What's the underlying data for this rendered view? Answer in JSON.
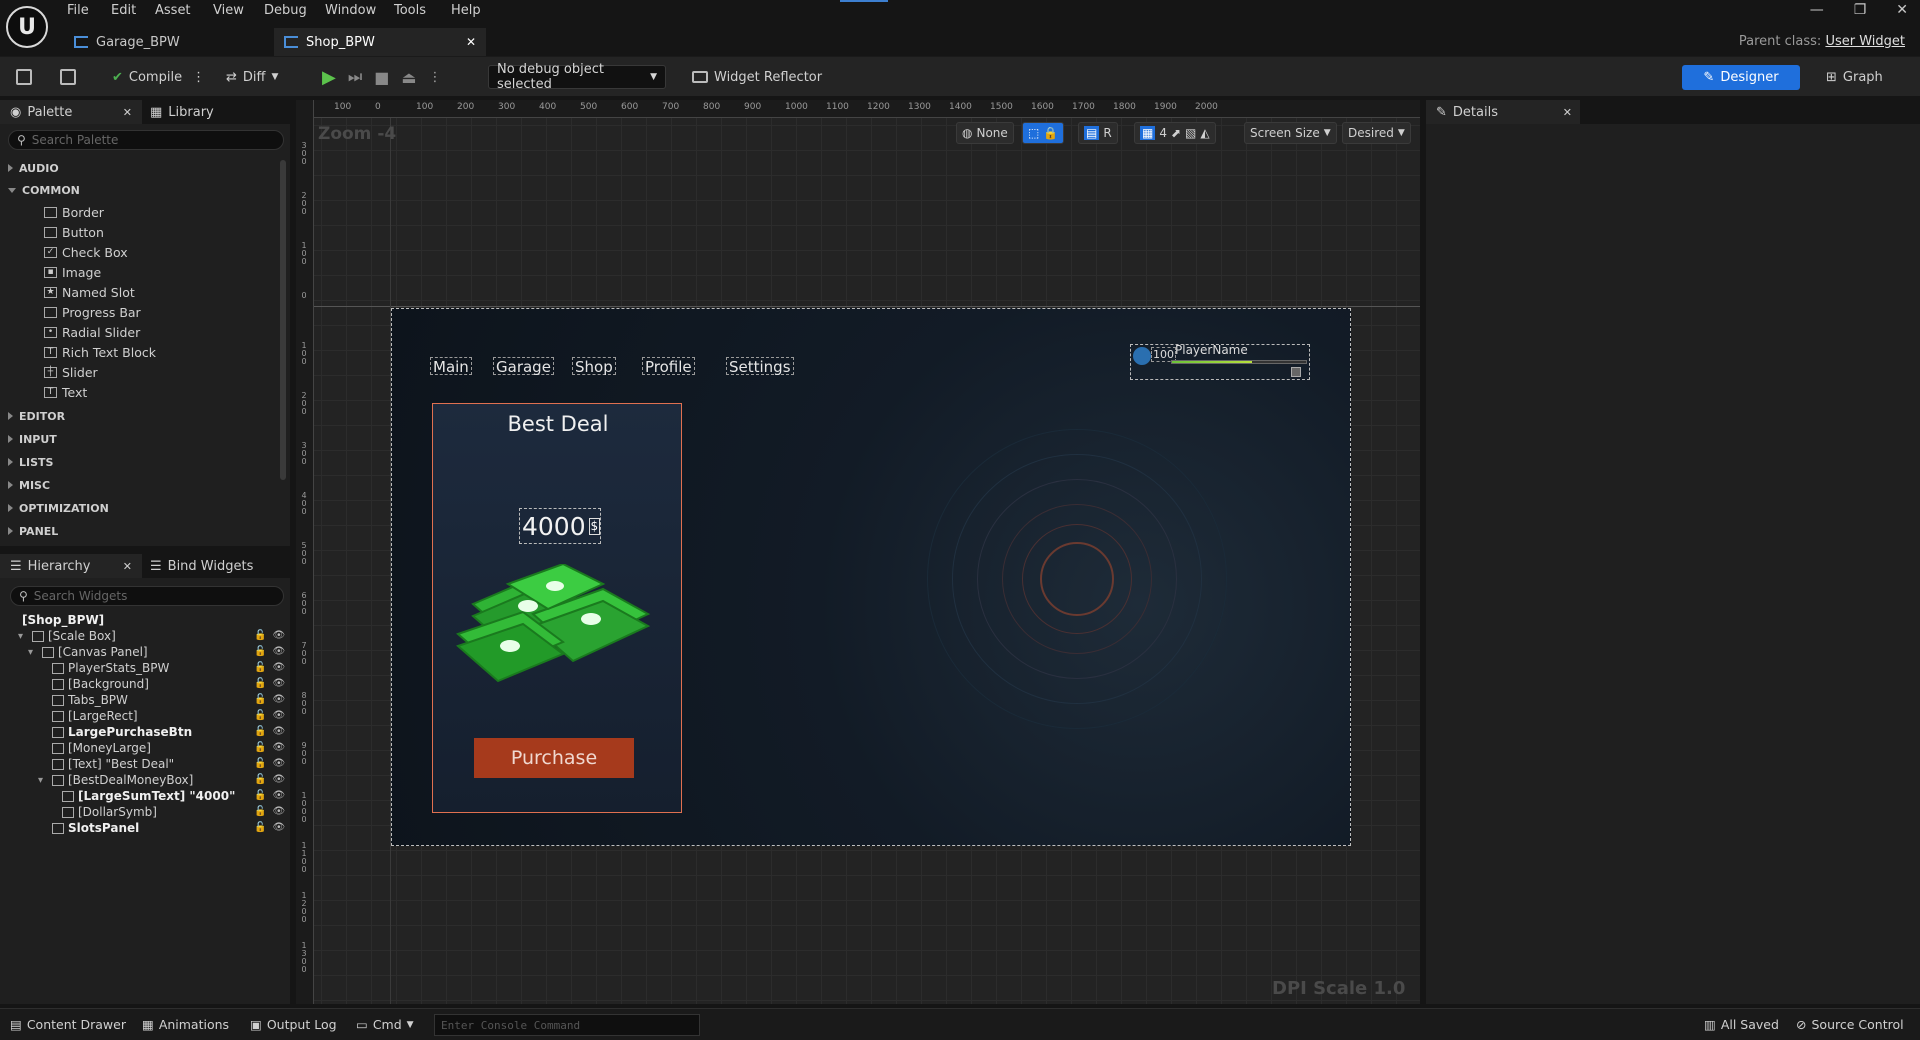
{
  "menu": [
    "File",
    "Edit",
    "Asset",
    "View",
    "Debug",
    "Window",
    "Tools",
    "Help"
  ],
  "tabs": [
    {
      "label": "Garage_BPW",
      "active": false
    },
    {
      "label": "Shop_BPW",
      "active": true
    }
  ],
  "parent_class": {
    "label": "Parent class:",
    "value": "User Widget"
  },
  "toolbar": {
    "compile": "Compile",
    "diff": "Diff",
    "debug_select": "No debug object selected",
    "widget_reflector": "Widget Reflector",
    "designer": "Designer",
    "graph": "Graph"
  },
  "palette": {
    "tab": "Palette",
    "library_tab": "Library",
    "search_placeholder": "Search Palette",
    "categories_top": [
      "AUDIO"
    ],
    "common_label": "COMMON",
    "common_items": [
      {
        "label": "Border",
        "icon": "border-icon",
        "glyph": ""
      },
      {
        "label": "Button",
        "icon": "button-icon",
        "glyph": ""
      },
      {
        "label": "Check Box",
        "icon": "checkbox-icon",
        "glyph": "✓"
      },
      {
        "label": "Image",
        "icon": "image-icon",
        "glyph": "▪"
      },
      {
        "label": "Named Slot",
        "icon": "named-slot-icon",
        "glyph": "★"
      },
      {
        "label": "Progress Bar",
        "icon": "progress-bar-icon",
        "glyph": ""
      },
      {
        "label": "Radial Slider",
        "icon": "radial-slider-icon",
        "glyph": "•"
      },
      {
        "label": "Rich Text Block",
        "icon": "rich-text-icon",
        "glyph": "T"
      },
      {
        "label": "Slider",
        "icon": "slider-icon",
        "glyph": "┼"
      },
      {
        "label": "Text",
        "icon": "text-icon",
        "glyph": "T"
      }
    ],
    "categories_bottom": [
      "EDITOR",
      "INPUT",
      "LISTS",
      "MISC",
      "OPTIMIZATION",
      "PANEL"
    ]
  },
  "hierarchy": {
    "tab": "Hierarchy",
    "bind_tab": "Bind Widgets",
    "search_placeholder": "Search Widgets",
    "items": [
      {
        "label": "[Shop_BPW]",
        "depth": 0,
        "bold": true,
        "expander": "",
        "icon": false
      },
      {
        "label": "[Scale Box]",
        "depth": 1,
        "bold": false,
        "expander": "▾",
        "icon": true
      },
      {
        "label": "[Canvas Panel]",
        "depth": 2,
        "bold": false,
        "expander": "▾",
        "icon": true
      },
      {
        "label": "PlayerStats_BPW",
        "depth": 3,
        "bold": false,
        "expander": "",
        "icon": true
      },
      {
        "label": "[Background]",
        "depth": 3,
        "bold": false,
        "expander": "",
        "icon": true
      },
      {
        "label": "Tabs_BPW",
        "depth": 3,
        "bold": false,
        "expander": "",
        "icon": true
      },
      {
        "label": "[LargeRect]",
        "depth": 3,
        "bold": false,
        "expander": "",
        "icon": true
      },
      {
        "label": "LargePurchaseBtn",
        "depth": 3,
        "bold": true,
        "expander": "",
        "icon": true
      },
      {
        "label": "[MoneyLarge]",
        "depth": 3,
        "bold": false,
        "expander": "",
        "icon": true
      },
      {
        "label": "[Text] \"Best Deal\"",
        "depth": 3,
        "bold": false,
        "expander": "",
        "icon": true
      },
      {
        "label": "[BestDealMoneyBox]",
        "depth": 3,
        "bold": false,
        "expander": "▾",
        "icon": true
      },
      {
        "label": "[LargeSumText] \"4000\"",
        "depth": 4,
        "bold": true,
        "expander": "",
        "icon": true
      },
      {
        "label": "[DollarSymb]",
        "depth": 4,
        "bold": false,
        "expander": "",
        "icon": true
      },
      {
        "label": "SlotsPanel",
        "depth": 3,
        "bold": true,
        "expander": "",
        "icon": true
      }
    ]
  },
  "viewport": {
    "zoom": "Zoom -4",
    "dpi": "DPI Scale 1.0",
    "ruler_top": [
      "100",
      "0",
      "100",
      "200",
      "300",
      "400",
      "500",
      "600",
      "700",
      "800",
      "900",
      "1000",
      "1100",
      "1200",
      "1300",
      "1400",
      "1500",
      "1600",
      "1700",
      "1800",
      "1900",
      "2000"
    ],
    "ruler_left": [
      "300",
      "200",
      "100",
      "0",
      "100",
      "200",
      "300",
      "400",
      "500",
      "600",
      "700",
      "800",
      "900",
      "1000",
      "1100",
      "1200",
      "1300"
    ],
    "ctl_none": "None",
    "ctl_r": "R",
    "ctl_grid": "4",
    "ctl_screen": "Screen Size",
    "ctl_desired": "Desired"
  },
  "game": {
    "tabs": [
      "Main",
      "Garage",
      "Shop",
      "Profile",
      "Settings"
    ],
    "deal_title": "Best Deal",
    "sum": "4000",
    "dollar": "$",
    "purchase": "Purchase",
    "player_level": "100",
    "player_name": "PlayerName"
  },
  "details": {
    "tab": "Details"
  },
  "statusbar": {
    "content_drawer": "Content Drawer",
    "animations": "Animations",
    "output_log": "Output Log",
    "cmd": "Cmd",
    "console_placeholder": "Enter Console Command",
    "all_saved": "All Saved",
    "source_control": "Source Control"
  }
}
